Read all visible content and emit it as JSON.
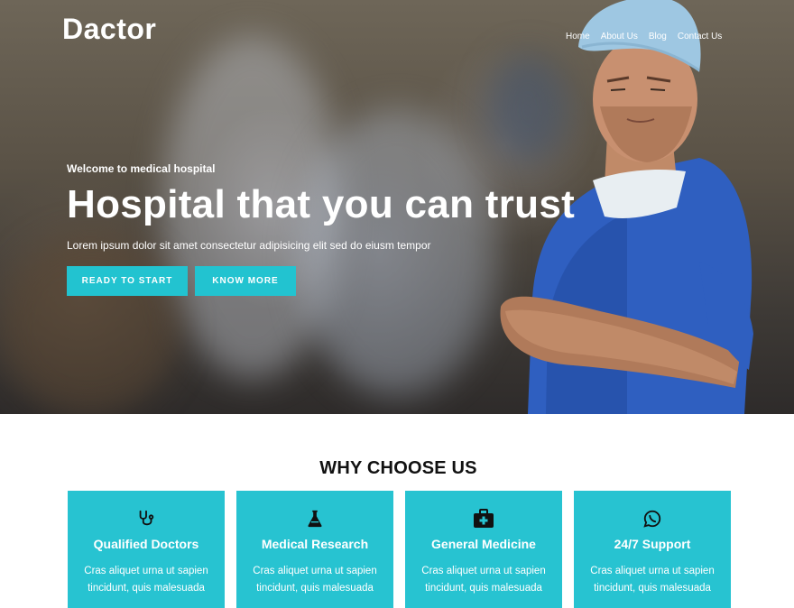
{
  "brand": {
    "logo": "Dactor"
  },
  "nav": {
    "items": [
      "Home",
      "About Us",
      "Blog",
      "Contact Us"
    ]
  },
  "hero": {
    "subtitle": "Welcome to medical hospital",
    "title": "Hospital that you can trust",
    "text": "Lorem ipsum dolor sit amet consectetur adipisicing elit sed do eiusm tempor",
    "primary_button": "READY TO START",
    "secondary_button": "KNOW MORE"
  },
  "why": {
    "title": "WHY CHOOSE US",
    "cards": [
      {
        "icon": "stethoscope-icon",
        "title": "Qualified Doctors",
        "line1": "Cras aliquet urna ut sapien",
        "line2": "tincidunt, quis malesuada"
      },
      {
        "icon": "flask-icon",
        "title": "Medical Research",
        "line1": "Cras aliquet urna ut sapien",
        "line2": "tincidunt, quis malesuada"
      },
      {
        "icon": "medical-kit-icon",
        "title": "General Medicine",
        "line1": "Cras aliquet urna ut sapien",
        "line2": "tincidunt, quis malesuada"
      },
      {
        "icon": "whatsapp-icon",
        "title": "24/7 Support",
        "line1": "Cras aliquet urna ut sapien",
        "line2": "tincidunt, quis malesuada"
      }
    ]
  },
  "colors": {
    "accent": "#22c3d0",
    "card": "#27c3d1",
    "heading": "#111111"
  }
}
